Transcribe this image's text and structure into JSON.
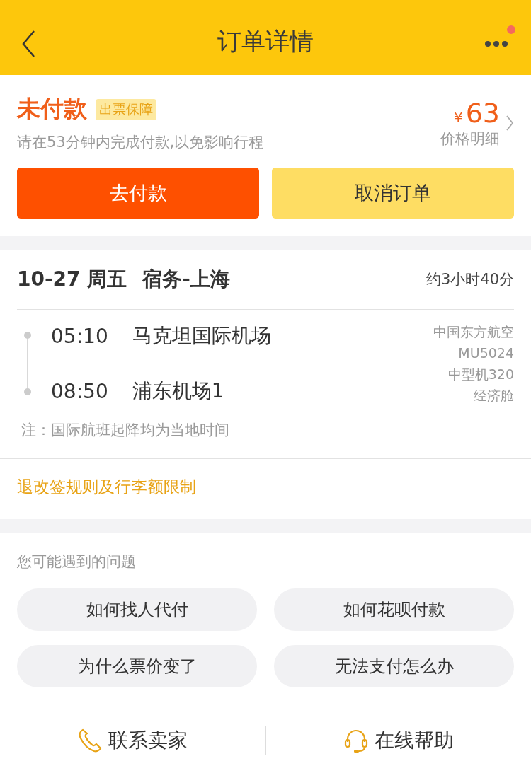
{
  "nav": {
    "title": "订单详情",
    "has_notification": true
  },
  "order": {
    "status": "未付款",
    "badge": "出票保障",
    "notice": "请在53分钟内完成付款,以免影响行程",
    "currency": "¥",
    "price": "63",
    "price_link": "价格明细"
  },
  "actions": [
    {
      "label": "去付款",
      "kind": "primary"
    },
    {
      "label": "取消订单",
      "kind": "secondary"
    }
  ],
  "flight": {
    "date": "10-27 周五",
    "route": "宿务-上海",
    "duration": "约3小时40分",
    "stops": [
      {
        "time": "05:10",
        "airport": "马克坦国际机场"
      },
      {
        "time": "08:50",
        "airport": "浦东机场1"
      }
    ],
    "details": [
      "中国东方航空",
      "MU5024",
      "中型机320",
      "经济舱"
    ],
    "note": "注：国际航班起降均为当地时间"
  },
  "rules_link": "退改签规则及行李额限制",
  "faq": {
    "title": "您可能遇到的问题",
    "items": [
      "如何找人代付",
      "如何花呗付款",
      "为什么票价变了",
      "无法支付怎么办"
    ]
  },
  "bottom": [
    {
      "label": "联系卖家",
      "kind": "phone"
    },
    {
      "label": "在线帮助",
      "kind": "headset"
    }
  ]
}
